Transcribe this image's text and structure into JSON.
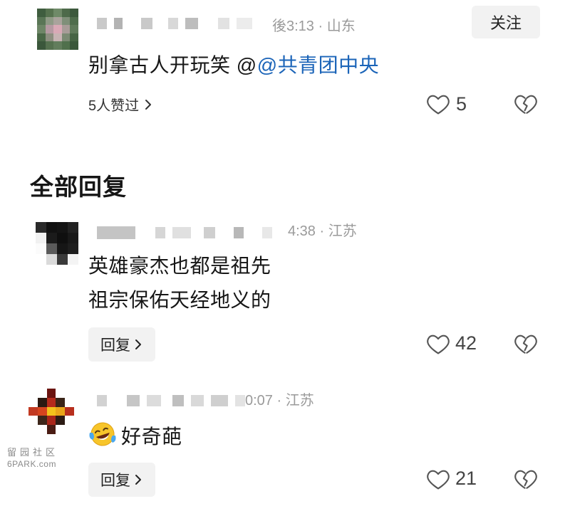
{
  "top_comment": {
    "timestamp": "後3:13 · 山东",
    "follow_label": "关注",
    "text": "别拿古人开玩笑 @",
    "mention": "@共青团中央",
    "likes_summary": "5人赞过",
    "like_count": "5"
  },
  "section_title": "全部回复",
  "replies": [
    {
      "timestamp": "4:38 · 江苏",
      "lines": [
        "英雄豪杰也都是祖先",
        "祖宗保佑天经地义的"
      ],
      "reply_label": "回复",
      "like_count": "42"
    },
    {
      "timestamp": "0:07 · 江苏",
      "emoji": "laughing-crying-emoji",
      "text": "好奇葩",
      "reply_label": "回复",
      "like_count": "21"
    }
  ],
  "watermark": {
    "line1": "留园社区",
    "line2": "6PARK.com"
  },
  "icons": {
    "like": "heart-outline-icon",
    "dislike": "broken-heart-icon",
    "chevron": "chevron-right-icon"
  },
  "colors": {
    "mention": "#1b64b8",
    "muted": "#9a9a9a",
    "button_bg": "#f2f2f2",
    "text": "#161616"
  }
}
